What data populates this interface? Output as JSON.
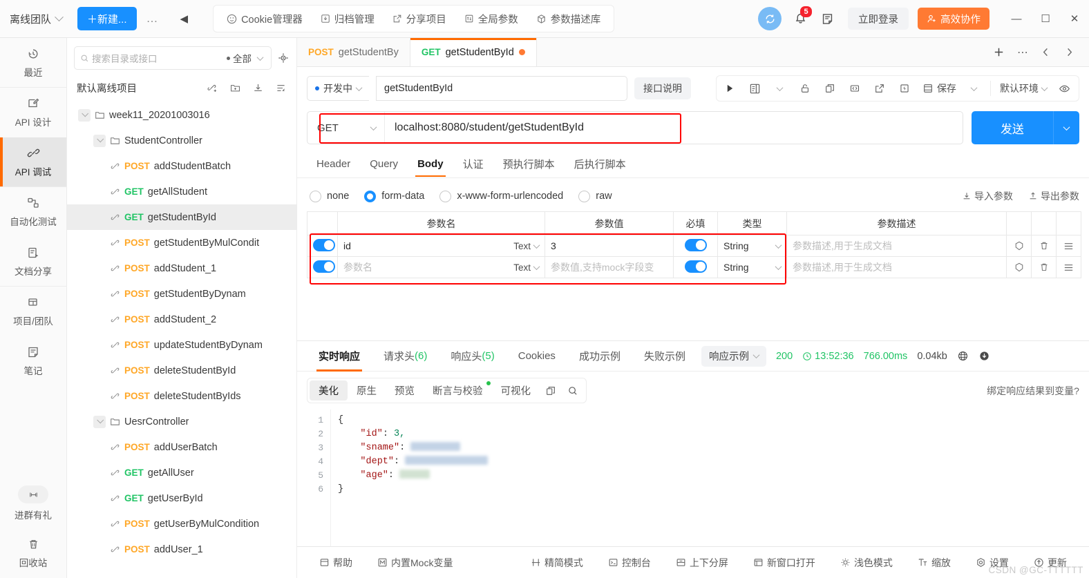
{
  "titlebar": {
    "team": "离线团队",
    "new_button": "＋新建...",
    "dots": "…",
    "tools": [
      {
        "label": "Cookie管理器",
        "icon": "cookie-icon"
      },
      {
        "label": "归档管理",
        "icon": "archive-icon"
      },
      {
        "label": "分享项目",
        "icon": "share-icon"
      },
      {
        "label": "全局参数",
        "icon": "global-params-icon"
      },
      {
        "label": "参数描述库",
        "icon": "param-lib-icon"
      }
    ],
    "notification_count": "5",
    "login": "立即登录",
    "coop": "高效协作",
    "minimize": "—",
    "maximize": "☐",
    "close": "✕"
  },
  "rail": {
    "items": [
      {
        "label": "最近",
        "icon": "history-icon",
        "active": false
      },
      {
        "label": "API 设计",
        "icon": "design-icon",
        "active": false
      },
      {
        "label": "API 调试",
        "icon": "debug-icon",
        "active": true
      },
      {
        "label": "自动化测试",
        "icon": "automation-icon",
        "active": false
      },
      {
        "label": "文档分享",
        "icon": "doc-share-icon",
        "active": false
      },
      {
        "label": "项目/团队",
        "icon": "project-team-icon",
        "active": false
      },
      {
        "label": "笔记",
        "icon": "notes-icon",
        "active": false
      }
    ],
    "bottom": [
      {
        "label": "进群有礼",
        "icon": "gift-icon"
      },
      {
        "label": "回收站",
        "icon": "trash-icon"
      }
    ]
  },
  "tree": {
    "search_placeholder": "搜索目录或接口",
    "scope": "全部",
    "project_name": "默认离线项目",
    "nodes": [
      {
        "level": 1,
        "type": "folder",
        "label": "week11_20201003016",
        "expanded": true
      },
      {
        "level": 2,
        "type": "folder",
        "label": "StudentController",
        "expanded": true
      },
      {
        "level": 3,
        "type": "api",
        "method": "POST",
        "label": "addStudentBatch"
      },
      {
        "level": 3,
        "type": "api",
        "method": "GET",
        "label": "getAllStudent"
      },
      {
        "level": 3,
        "type": "api",
        "method": "GET",
        "label": "getStudentById",
        "selected": true
      },
      {
        "level": 3,
        "type": "api",
        "method": "POST",
        "label": "getStudentByMulCondit"
      },
      {
        "level": 3,
        "type": "api",
        "method": "POST",
        "label": "addStudent_1"
      },
      {
        "level": 3,
        "type": "api",
        "method": "POST",
        "label": "getStudentByDynam"
      },
      {
        "level": 3,
        "type": "api",
        "method": "POST",
        "label": "addStudent_2"
      },
      {
        "level": 3,
        "type": "api",
        "method": "POST",
        "label": "updateStudentByDynam"
      },
      {
        "level": 3,
        "type": "api",
        "method": "POST",
        "label": "deleteStudentById"
      },
      {
        "level": 3,
        "type": "api",
        "method": "POST",
        "label": "deleteStudentByIds"
      },
      {
        "level": 2,
        "type": "folder",
        "label": "UesrController",
        "expanded": true
      },
      {
        "level": 3,
        "type": "api",
        "method": "POST",
        "label": "addUserBatch"
      },
      {
        "level": 3,
        "type": "api",
        "method": "GET",
        "label": "getAllUser"
      },
      {
        "level": 3,
        "type": "api",
        "method": "GET",
        "label": "getUserById"
      },
      {
        "level": 3,
        "type": "api",
        "method": "POST",
        "label": "getUserByMulCondition"
      },
      {
        "level": 3,
        "type": "api",
        "method": "POST",
        "label": "addUser_1"
      }
    ]
  },
  "request_tabs": [
    {
      "method": "POST",
      "label": "getStudentBy",
      "active": false,
      "dirty": false
    },
    {
      "method": "GET",
      "label": "getStudentById",
      "active": true,
      "dirty": true
    }
  ],
  "request": {
    "status": "开发中",
    "name": "getStudentById",
    "desc_button": "接口说明",
    "save_label": "保存",
    "env_label": "默认环境",
    "method": "GET",
    "url": "localhost:8080/student/getStudentById",
    "send": "发送",
    "tabs": [
      {
        "label": "Header",
        "active": false
      },
      {
        "label": "Query",
        "active": false
      },
      {
        "label": "Body",
        "active": true
      },
      {
        "label": "认证",
        "active": false
      },
      {
        "label": "预执行脚本",
        "active": false
      },
      {
        "label": "后执行脚本",
        "active": false
      }
    ],
    "body_types": [
      {
        "label": "none",
        "selected": false
      },
      {
        "label": "form-data",
        "selected": true
      },
      {
        "label": "x-www-form-urlencoded",
        "selected": false
      },
      {
        "label": "raw",
        "selected": false
      }
    ],
    "import_params": "导入参数",
    "export_params": "导出参数",
    "param_table": {
      "headers": [
        "",
        "参数名",
        "参数值",
        "必填",
        "类型",
        "参数描述",
        "",
        "",
        ""
      ],
      "rows": [
        {
          "enabled": true,
          "name": "id",
          "name_placeholder": "参数名",
          "name_type": "Text",
          "value": "3",
          "value_placeholder": "参数值,支持mock字段变",
          "required": true,
          "type": "String",
          "desc": "",
          "desc_placeholder": "参数描述,用于生成文档"
        },
        {
          "enabled": true,
          "name": "",
          "name_placeholder": "参数名",
          "name_type": "Text",
          "value": "",
          "value_placeholder": "参数值,支持mock字段变",
          "required": true,
          "type": "String",
          "desc": "",
          "desc_placeholder": "参数描述,用于生成文档"
        }
      ]
    }
  },
  "response": {
    "tabs": [
      {
        "label": "实时响应",
        "count": "",
        "active": true
      },
      {
        "label": "请求头",
        "count": "(6)",
        "active": false
      },
      {
        "label": "响应头",
        "count": "(5)",
        "active": false
      },
      {
        "label": "Cookies",
        "count": "",
        "active": false
      },
      {
        "label": "成功示例",
        "count": "",
        "active": false
      },
      {
        "label": "失败示例",
        "count": "",
        "active": false
      }
    ],
    "example_select": "响应示例",
    "status_code": "200",
    "time": "13:52:36",
    "duration": "766.00ms",
    "size": "0.04kb",
    "format_tabs": [
      {
        "label": "美化",
        "active": true,
        "dot": false
      },
      {
        "label": "原生",
        "active": false,
        "dot": false
      },
      {
        "label": "预览",
        "active": false,
        "dot": false
      },
      {
        "label": "断言与校验",
        "active": false,
        "dot": true
      },
      {
        "label": "可视化",
        "active": false,
        "dot": false
      }
    ],
    "bind_var": "绑定响应结果到变量?",
    "line_numbers": [
      "1",
      "2",
      "3",
      "4",
      "5",
      "6"
    ],
    "code_lines": [
      {
        "text": "{",
        "type": "brace"
      },
      {
        "key": "\"id\"",
        "value": "3,",
        "value_kind": "number"
      },
      {
        "key": "\"sname\"",
        "value": "",
        "value_kind": "redacted-small"
      },
      {
        "key": "\"dept\"",
        "value": "",
        "value_kind": "redacted-large"
      },
      {
        "key": "\"age\"",
        "value": "",
        "value_kind": "redacted-tiny"
      },
      {
        "text": "}",
        "type": "brace"
      }
    ]
  },
  "footer": {
    "left": [
      {
        "label": "帮助",
        "icon": "help-icon"
      },
      {
        "label": "内置Mock变量",
        "icon": "mock-icon"
      }
    ],
    "right": [
      {
        "label": "精简模式",
        "icon": "compact-icon"
      },
      {
        "label": "控制台",
        "icon": "console-icon"
      },
      {
        "label": "上下分屏",
        "icon": "split-icon"
      },
      {
        "label": "新窗口打开",
        "icon": "new-window-icon"
      },
      {
        "label": "浅色模式",
        "icon": "light-mode-icon"
      },
      {
        "label": "缩放",
        "icon": "zoom-icon"
      },
      {
        "label": "设置",
        "icon": "settings-icon"
      },
      {
        "label": "更新",
        "icon": "update-icon"
      }
    ],
    "watermark": "CSDN @GC-TTTTTT"
  },
  "colors": {
    "accent_blue": "#1890ff",
    "accent_orange": "#ff6a00",
    "get_green": "#21c465",
    "post_orange": "#ffa726",
    "highlight_red": "#ff0000"
  }
}
